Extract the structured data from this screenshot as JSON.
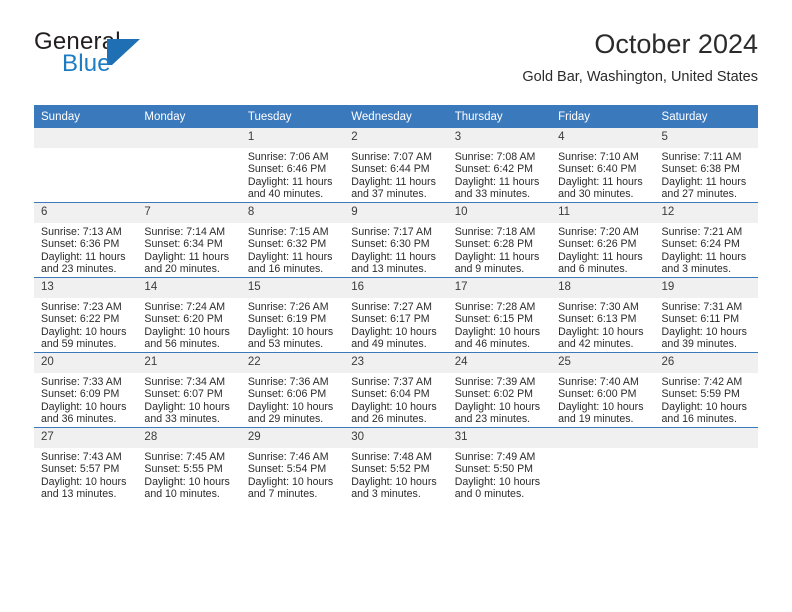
{
  "brand": {
    "word1": "General",
    "word2": "Blue",
    "logo_icon": "general-blue-triangle-logo",
    "blue": "#1f6fb5"
  },
  "header": {
    "title": "October 2024",
    "subtitle": "Gold Bar, Washington, United States"
  },
  "theme": {
    "header_blue": "#3b79bd",
    "daynum_band": "#f0f0f0",
    "text": "#2b2b2b"
  },
  "weekday_headers": [
    "Sunday",
    "Monday",
    "Tuesday",
    "Wednesday",
    "Thursday",
    "Friday",
    "Saturday"
  ],
  "labels": {
    "sunrise_prefix": "Sunrise: ",
    "sunset_prefix": "Sunset: ",
    "daylight_prefix": "Daylight: "
  },
  "weeks": [
    [
      {
        "day": "",
        "sunrise": "",
        "sunset": "",
        "daylight_line1": "",
        "daylight_line2": ""
      },
      {
        "day": "",
        "sunrise": "",
        "sunset": "",
        "daylight_line1": "",
        "daylight_line2": ""
      },
      {
        "day": "1",
        "sunrise": "Sunrise: 7:06 AM",
        "sunset": "Sunset: 6:46 PM",
        "daylight_line1": "Daylight: 11 hours",
        "daylight_line2": "and 40 minutes."
      },
      {
        "day": "2",
        "sunrise": "Sunrise: 7:07 AM",
        "sunset": "Sunset: 6:44 PM",
        "daylight_line1": "Daylight: 11 hours",
        "daylight_line2": "and 37 minutes."
      },
      {
        "day": "3",
        "sunrise": "Sunrise: 7:08 AM",
        "sunset": "Sunset: 6:42 PM",
        "daylight_line1": "Daylight: 11 hours",
        "daylight_line2": "and 33 minutes."
      },
      {
        "day": "4",
        "sunrise": "Sunrise: 7:10 AM",
        "sunset": "Sunset: 6:40 PM",
        "daylight_line1": "Daylight: 11 hours",
        "daylight_line2": "and 30 minutes."
      },
      {
        "day": "5",
        "sunrise": "Sunrise: 7:11 AM",
        "sunset": "Sunset: 6:38 PM",
        "daylight_line1": "Daylight: 11 hours",
        "daylight_line2": "and 27 minutes."
      }
    ],
    [
      {
        "day": "6",
        "sunrise": "Sunrise: 7:13 AM",
        "sunset": "Sunset: 6:36 PM",
        "daylight_line1": "Daylight: 11 hours",
        "daylight_line2": "and 23 minutes."
      },
      {
        "day": "7",
        "sunrise": "Sunrise: 7:14 AM",
        "sunset": "Sunset: 6:34 PM",
        "daylight_line1": "Daylight: 11 hours",
        "daylight_line2": "and 20 minutes."
      },
      {
        "day": "8",
        "sunrise": "Sunrise: 7:15 AM",
        "sunset": "Sunset: 6:32 PM",
        "daylight_line1": "Daylight: 11 hours",
        "daylight_line2": "and 16 minutes."
      },
      {
        "day": "9",
        "sunrise": "Sunrise: 7:17 AM",
        "sunset": "Sunset: 6:30 PM",
        "daylight_line1": "Daylight: 11 hours",
        "daylight_line2": "and 13 minutes."
      },
      {
        "day": "10",
        "sunrise": "Sunrise: 7:18 AM",
        "sunset": "Sunset: 6:28 PM",
        "daylight_line1": "Daylight: 11 hours",
        "daylight_line2": "and 9 minutes."
      },
      {
        "day": "11",
        "sunrise": "Sunrise: 7:20 AM",
        "sunset": "Sunset: 6:26 PM",
        "daylight_line1": "Daylight: 11 hours",
        "daylight_line2": "and 6 minutes."
      },
      {
        "day": "12",
        "sunrise": "Sunrise: 7:21 AM",
        "sunset": "Sunset: 6:24 PM",
        "daylight_line1": "Daylight: 11 hours",
        "daylight_line2": "and 3 minutes."
      }
    ],
    [
      {
        "day": "13",
        "sunrise": "Sunrise: 7:23 AM",
        "sunset": "Sunset: 6:22 PM",
        "daylight_line1": "Daylight: 10 hours",
        "daylight_line2": "and 59 minutes."
      },
      {
        "day": "14",
        "sunrise": "Sunrise: 7:24 AM",
        "sunset": "Sunset: 6:20 PM",
        "daylight_line1": "Daylight: 10 hours",
        "daylight_line2": "and 56 minutes."
      },
      {
        "day": "15",
        "sunrise": "Sunrise: 7:26 AM",
        "sunset": "Sunset: 6:19 PM",
        "daylight_line1": "Daylight: 10 hours",
        "daylight_line2": "and 53 minutes."
      },
      {
        "day": "16",
        "sunrise": "Sunrise: 7:27 AM",
        "sunset": "Sunset: 6:17 PM",
        "daylight_line1": "Daylight: 10 hours",
        "daylight_line2": "and 49 minutes."
      },
      {
        "day": "17",
        "sunrise": "Sunrise: 7:28 AM",
        "sunset": "Sunset: 6:15 PM",
        "daylight_line1": "Daylight: 10 hours",
        "daylight_line2": "and 46 minutes."
      },
      {
        "day": "18",
        "sunrise": "Sunrise: 7:30 AM",
        "sunset": "Sunset: 6:13 PM",
        "daylight_line1": "Daylight: 10 hours",
        "daylight_line2": "and 42 minutes."
      },
      {
        "day": "19",
        "sunrise": "Sunrise: 7:31 AM",
        "sunset": "Sunset: 6:11 PM",
        "daylight_line1": "Daylight: 10 hours",
        "daylight_line2": "and 39 minutes."
      }
    ],
    [
      {
        "day": "20",
        "sunrise": "Sunrise: 7:33 AM",
        "sunset": "Sunset: 6:09 PM",
        "daylight_line1": "Daylight: 10 hours",
        "daylight_line2": "and 36 minutes."
      },
      {
        "day": "21",
        "sunrise": "Sunrise: 7:34 AM",
        "sunset": "Sunset: 6:07 PM",
        "daylight_line1": "Daylight: 10 hours",
        "daylight_line2": "and 33 minutes."
      },
      {
        "day": "22",
        "sunrise": "Sunrise: 7:36 AM",
        "sunset": "Sunset: 6:06 PM",
        "daylight_line1": "Daylight: 10 hours",
        "daylight_line2": "and 29 minutes."
      },
      {
        "day": "23",
        "sunrise": "Sunrise: 7:37 AM",
        "sunset": "Sunset: 6:04 PM",
        "daylight_line1": "Daylight: 10 hours",
        "daylight_line2": "and 26 minutes."
      },
      {
        "day": "24",
        "sunrise": "Sunrise: 7:39 AM",
        "sunset": "Sunset: 6:02 PM",
        "daylight_line1": "Daylight: 10 hours",
        "daylight_line2": "and 23 minutes."
      },
      {
        "day": "25",
        "sunrise": "Sunrise: 7:40 AM",
        "sunset": "Sunset: 6:00 PM",
        "daylight_line1": "Daylight: 10 hours",
        "daylight_line2": "and 19 minutes."
      },
      {
        "day": "26",
        "sunrise": "Sunrise: 7:42 AM",
        "sunset": "Sunset: 5:59 PM",
        "daylight_line1": "Daylight: 10 hours",
        "daylight_line2": "and 16 minutes."
      }
    ],
    [
      {
        "day": "27",
        "sunrise": "Sunrise: 7:43 AM",
        "sunset": "Sunset: 5:57 PM",
        "daylight_line1": "Daylight: 10 hours",
        "daylight_line2": "and 13 minutes."
      },
      {
        "day": "28",
        "sunrise": "Sunrise: 7:45 AM",
        "sunset": "Sunset: 5:55 PM",
        "daylight_line1": "Daylight: 10 hours",
        "daylight_line2": "and 10 minutes."
      },
      {
        "day": "29",
        "sunrise": "Sunrise: 7:46 AM",
        "sunset": "Sunset: 5:54 PM",
        "daylight_line1": "Daylight: 10 hours",
        "daylight_line2": "and 7 minutes."
      },
      {
        "day": "30",
        "sunrise": "Sunrise: 7:48 AM",
        "sunset": "Sunset: 5:52 PM",
        "daylight_line1": "Daylight: 10 hours",
        "daylight_line2": "and 3 minutes."
      },
      {
        "day": "31",
        "sunrise": "Sunrise: 7:49 AM",
        "sunset": "Sunset: 5:50 PM",
        "daylight_line1": "Daylight: 10 hours",
        "daylight_line2": "and 0 minutes."
      },
      {
        "day": "",
        "sunrise": "",
        "sunset": "",
        "daylight_line1": "",
        "daylight_line2": ""
      },
      {
        "day": "",
        "sunrise": "",
        "sunset": "",
        "daylight_line1": "",
        "daylight_line2": ""
      }
    ]
  ]
}
